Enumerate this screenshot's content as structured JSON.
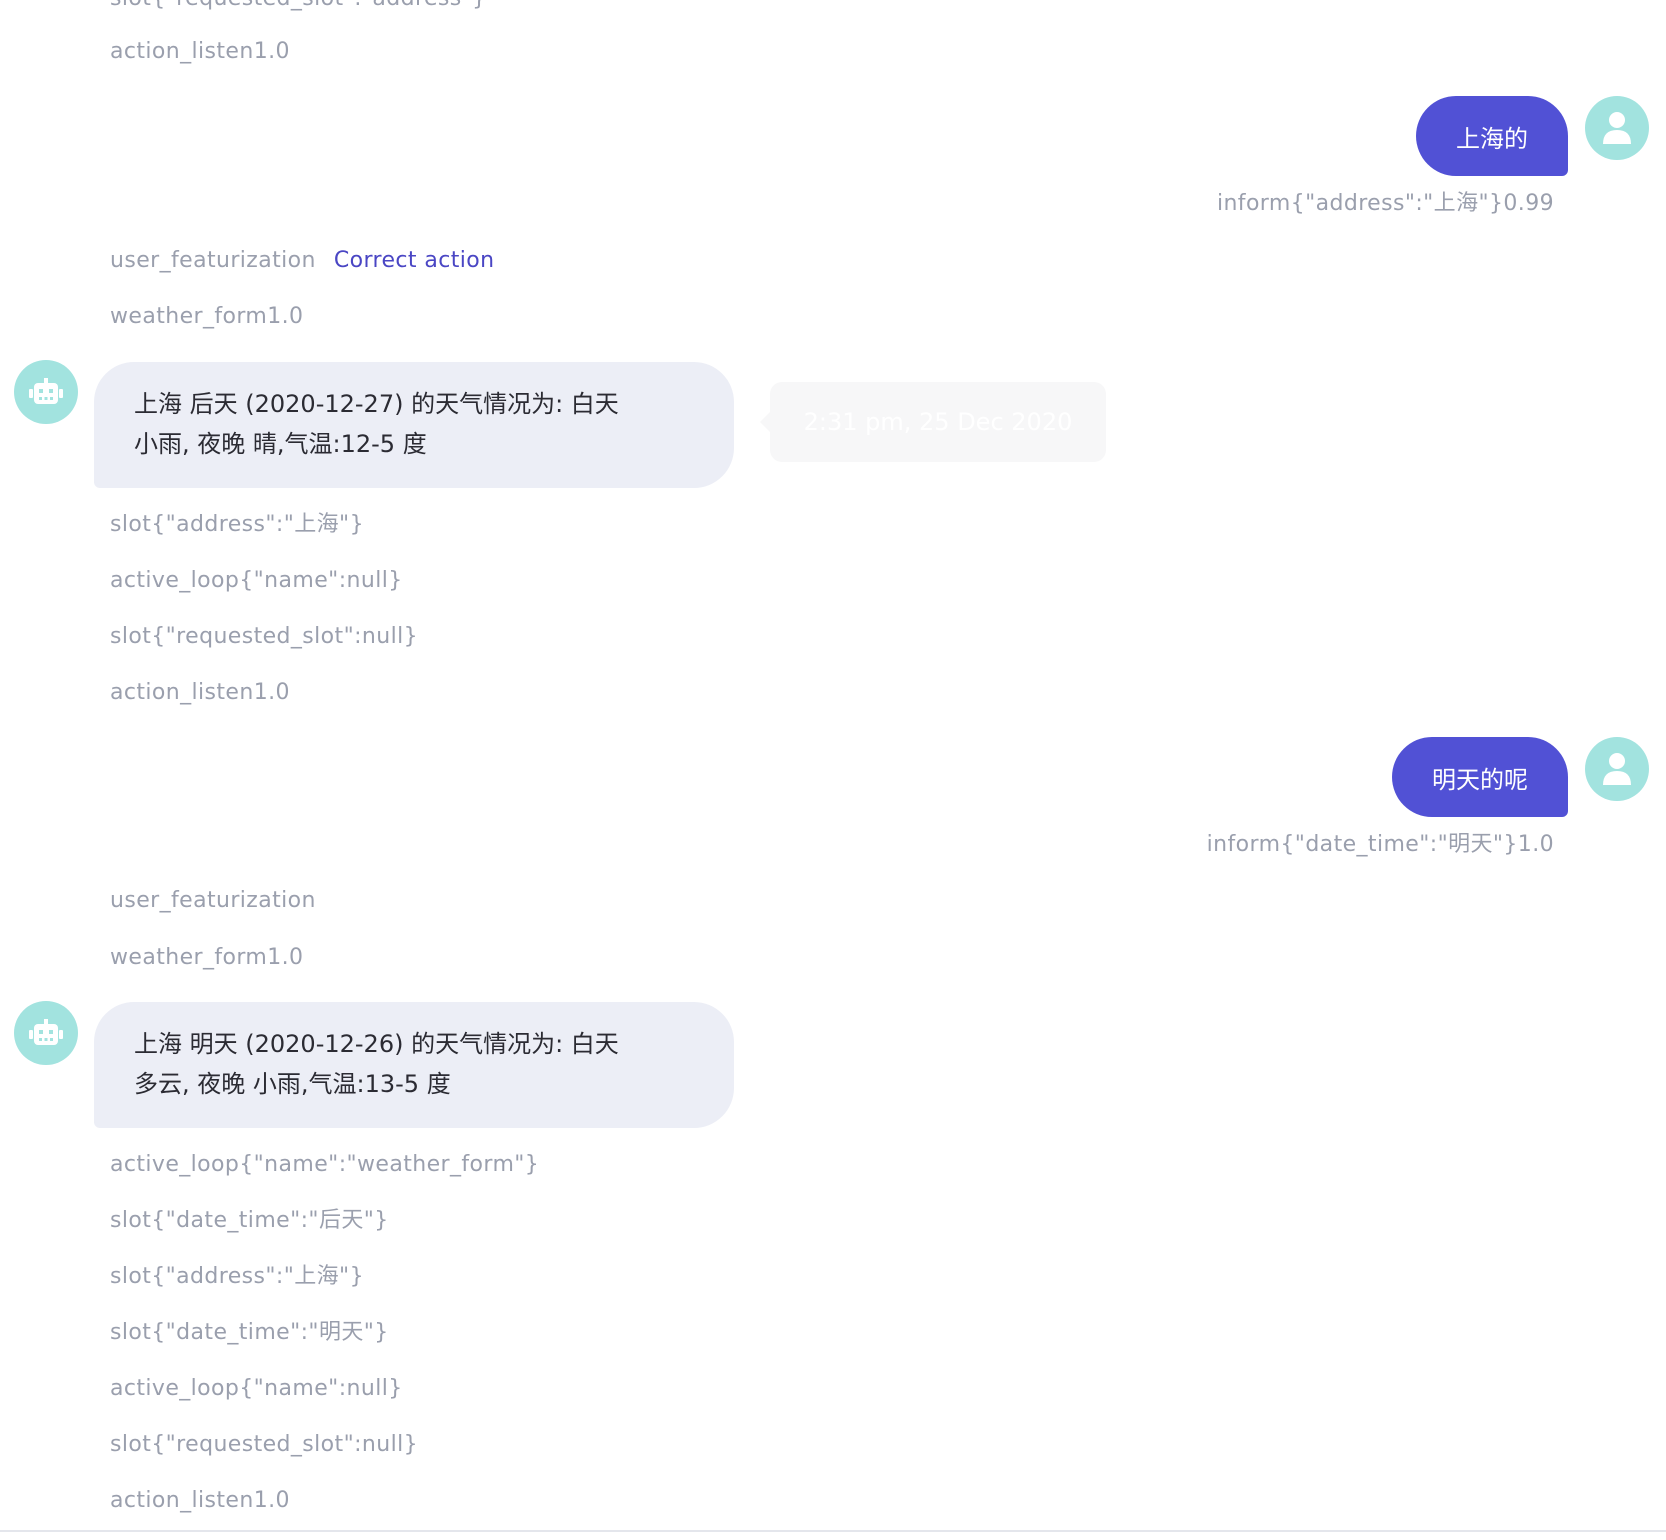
{
  "events_top": [
    "slot{\"requested_slot\":\"address\"}",
    "action_listen1.0"
  ],
  "turn1": {
    "user_message": "上海的",
    "user_intent": "inform{\"address\":\"上海\"}0.99",
    "featurization_label": "user_featurization",
    "correct_action_label": "Correct action",
    "action_before": "weather_form1.0",
    "bot_lines": [
      "上海 后天 (2020-12-27) 的天气情况为: 白天",
      "小雨, 夜晚 晴,气温:12-5 度"
    ],
    "tooltip": "2:31 pm, 25 Dec 2020",
    "events_after": [
      "slot{\"address\":\"上海\"}",
      "active_loop{\"name\":null}",
      "slot{\"requested_slot\":null}",
      "action_listen1.0"
    ]
  },
  "turn2": {
    "user_message": "明天的呢",
    "user_intent": "inform{\"date_time\":\"明天\"}1.0",
    "featurization_label": "user_featurization",
    "action_before": "weather_form1.0",
    "bot_lines": [
      "上海 明天 (2020-12-26) 的天气情况为: 白天",
      "多云, 夜晚 小雨,气温:13-5 度"
    ],
    "events_after": [
      "active_loop{\"name\":\"weather_form\"}",
      "slot{\"date_time\":\"后天\"}",
      "slot{\"address\":\"上海\"}",
      "slot{\"date_time\":\"明天\"}",
      "active_loop{\"name\":null}",
      "slot{\"requested_slot\":null}",
      "action_listen1.0"
    ]
  },
  "icons": {
    "user_avatar": "user-icon",
    "bot_avatar": "robot-icon"
  },
  "colors": {
    "user_bubble": "#5151d5",
    "bot_bubble": "#eceef6",
    "avatar": "#a2e3df",
    "event_text": "#9a9fad",
    "link": "#4a46c4"
  }
}
